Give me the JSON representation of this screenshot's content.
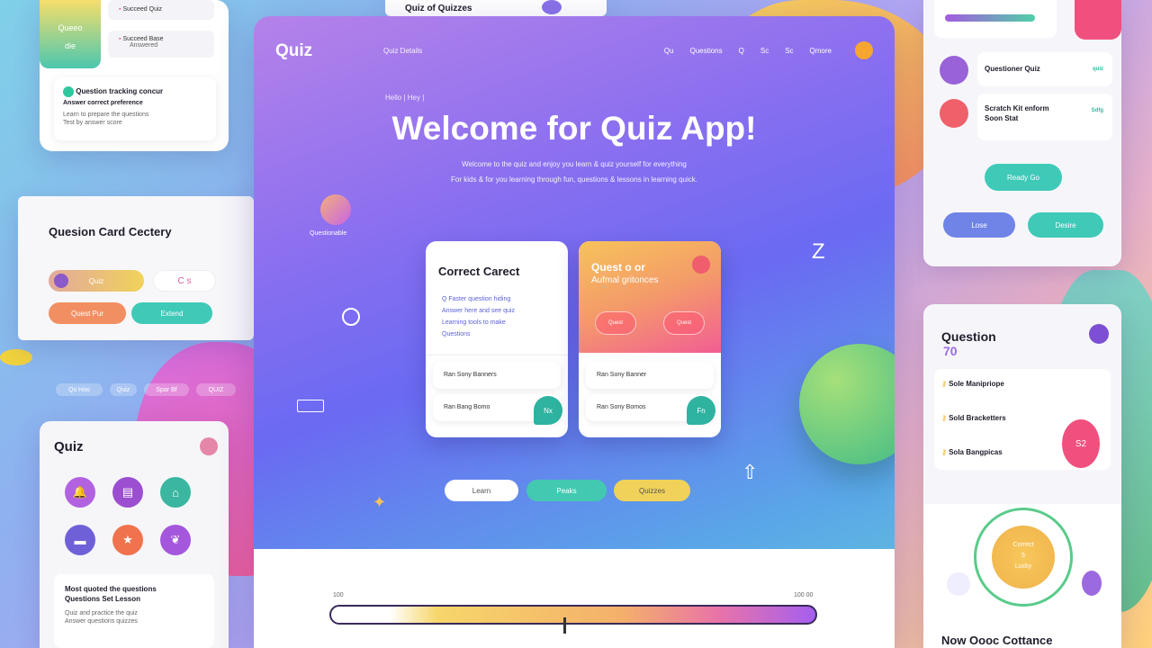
{
  "main": {
    "logo": "Quiz",
    "crumb": "Quiz Details",
    "nav": [
      "Qu",
      "Questions",
      "Q",
      "Sc",
      "Sc",
      "Qmore"
    ],
    "hero_small": "Hello  |  Hey  |",
    "title": "Welcome for Quiz App!",
    "sub1": "Welcome to the quiz and enjoy you learn & quiz yourself for everything",
    "sub2": "For kids & for you learning through fun, questions & lessons in learning quick.",
    "card1": {
      "title": "Correct Carect",
      "lines": [
        "Q Faster question hiding",
        "Answer here and see quiz",
        "Learning tools to make",
        "Questions"
      ],
      "row1": "Ran Sony Banners",
      "row2": "Ran Bang Bomo",
      "badge": "Nx"
    },
    "card2": {
      "title": "Quest o or",
      "sub": "Aufmal gritonces",
      "chip1": "Quest",
      "chip2": "Quest",
      "row1": "Ran Sony Banner",
      "row2": "Ran Sony Bomos",
      "badge": "Fn"
    },
    "buttons": [
      "Learn",
      "Peaks",
      "Quizzes"
    ],
    "avatar_label": "Questionable",
    "progress_left": "100",
    "progress_right": "100 00",
    "progress_value": 0.48
  },
  "top_left": {
    "tile_top": "Queeo",
    "tile_bottom": "die",
    "item1": "Succeed Quiz",
    "item2": "Succeed Base",
    "item2_sub": "Answered",
    "notice_title": "Question tracking concur",
    "notice_sub": "Answer correct preference",
    "notice_lines": [
      "Learn to prepare the questions",
      "Test by answer score"
    ]
  },
  "question_card": {
    "title": "Quesion Card Cectery",
    "pill1": "Quiz",
    "pill2": "C s",
    "pill3": "Quest Pur",
    "pill4": "Extend"
  },
  "left_tags": [
    "Qs Hoo",
    "Quiz",
    "Spar Bf",
    "QUIZ"
  ],
  "quiz_panel": {
    "title": "Quiz",
    "note_title": "Most quoted the questions",
    "note_sub": "Questions Set Lesson",
    "note_lines": [
      "Quiz and practice the quiz",
      "Answer questions quizzes"
    ]
  },
  "top_center": {
    "title": "Quiz of Quizzes"
  },
  "right_top": {
    "item1": "Questioner Quiz",
    "item1_tag": "quiz",
    "item2": "Scratch Kit enform",
    "item2_sub": "Soon Stat",
    "item2_tag": "Sdfg",
    "btn1": "Ready Go",
    "btn2": "Lose",
    "btn3": "Desire"
  },
  "right_bottom": {
    "title": "Question",
    "num": "70",
    "rows": [
      "Sole Manipriope",
      "Sold Bracketters",
      "Sola Bangpicas"
    ],
    "bubble": "S2",
    "ring_line1": "Correct",
    "ring_line2": "5",
    "ring_line3": "Lucky",
    "footer": "Now Oooc Cottance"
  },
  "colors": {
    "purple": "#9b62e6",
    "teal": "#3ccbb8",
    "yellow": "#f0d25a",
    "orange": "#f4995a",
    "pink": "#f25e93",
    "green": "#5cc985"
  },
  "icons": [
    "bell-icon",
    "clipboard-icon",
    "hat-icon",
    "book-icon",
    "star-icon",
    "leaf-icon"
  ]
}
